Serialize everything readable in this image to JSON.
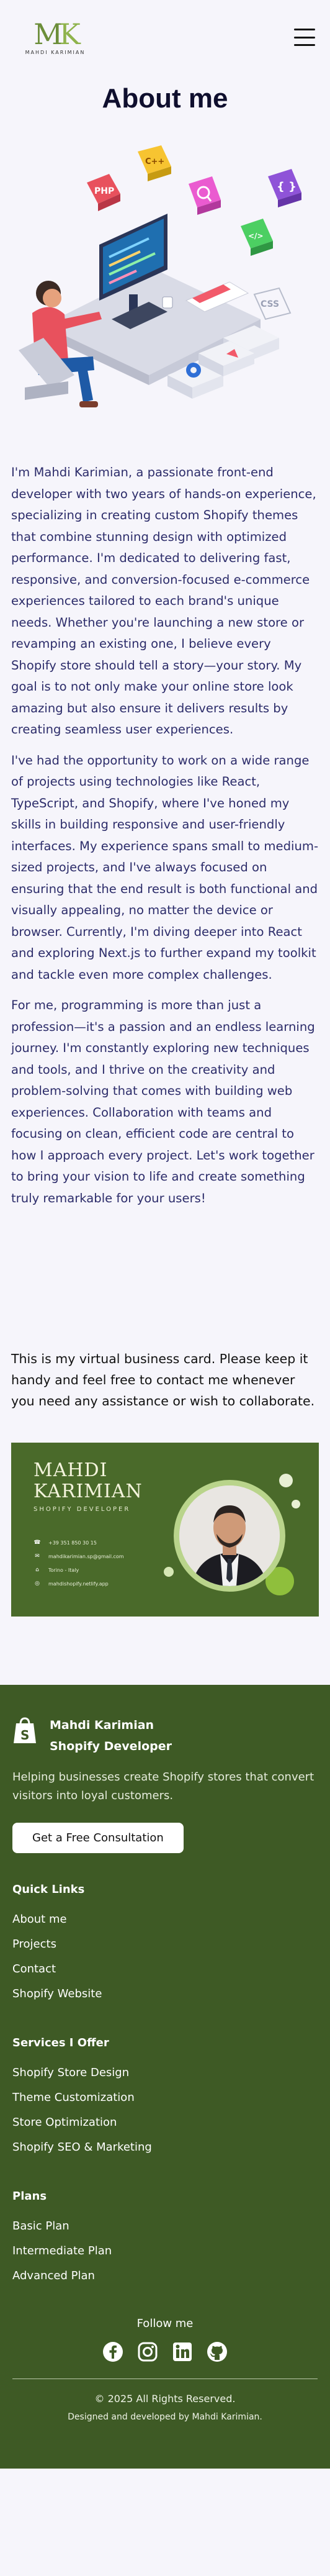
{
  "header": {
    "logo_mark_m": "M",
    "logo_mark_k": "K",
    "logo_sub": "MAHDI KARIMIAN"
  },
  "hero": {
    "title": "About me",
    "badges": [
      "PHP",
      "C++",
      "</>",
      "CSS"
    ]
  },
  "about": {
    "paragraphs": [
      "I'm Mahdi Karimian, a passionate front-end developer with two years of hands-on experience, specializing in creating custom Shopify themes that combine stunning design with optimized performance. I'm dedicated to delivering fast, responsive, and conversion-focused e-commerce experiences tailored to each brand's unique needs. Whether you're launching a new store or revamping an existing one, I believe every Shopify store should tell a story—your story. My goal is to not only make your online store look amazing but also ensure it delivers results by creating seamless user experiences.",
      "I've had the opportunity to work on a wide range of projects using technologies like React, TypeScript, and Shopify, where I've honed my skills in building responsive and user-friendly interfaces. My experience spans small to medium-sized projects, and I've always focused on ensuring that the end result is both functional and visually appealing, no matter the device or browser. Currently, I'm diving deeper into React and exploring Next.js to further expand my toolkit and tackle even more complex challenges.",
      "For me, programming is more than just a profession—it's a passion and an endless learning journey. I'm constantly exploring new techniques and tools, and I thrive on the creativity and problem-solving that comes with building web experiences. Collaboration with teams and focusing on clean, efficient code are central to how I approach every project. Let's work together to bring your vision to life and create something truly remarkable for your users!"
    ]
  },
  "vcard": {
    "intro": "This is my virtual business card. Please keep it handy and feel free to contact me whenever you need any assistance or wish to collaborate.",
    "name_line1": "MAHDI",
    "name_line2": "KARIMIAN",
    "role": "SHOPIFY DEVELOPER",
    "contacts": [
      {
        "icon": "phone-icon",
        "text": "+39 351 850 30 15"
      },
      {
        "icon": "mail-icon",
        "text": "mahdikarimian.sp@gmail.com"
      },
      {
        "icon": "location-icon",
        "text": "Torino - Italy"
      },
      {
        "icon": "globe-icon",
        "text": "mahdishopify.netlify.app"
      }
    ],
    "colors": {
      "bg": "#4a6a2a",
      "accent": "#b9d48b"
    }
  },
  "footer": {
    "brand_line1": "Mahdi Karimian",
    "brand_line2": "Shopify Developer",
    "description": "Helping businesses create Shopify stores that convert visitors into loyal customers.",
    "cta": "Get a Free Consultation",
    "quick_links": {
      "title": "Quick Links",
      "items": [
        "About me",
        "Projects",
        "Contact",
        "Shopify Website"
      ]
    },
    "services": {
      "title": "Services I Offer",
      "items": [
        "Shopify Store Design",
        "Theme Customization",
        "Store Optimization",
        "Shopify SEO & Marketing"
      ]
    },
    "plans": {
      "title": "Plans",
      "items": [
        "Basic Plan",
        "Intermediate Plan",
        "Advanced Plan"
      ]
    },
    "follow": "Follow me",
    "socials": [
      "facebook-icon",
      "instagram-icon",
      "linkedin-icon",
      "github-icon"
    ],
    "copyright": "© 2025 All Rights Reserved.",
    "credit": "Designed and developed by Mahdi Karimian."
  }
}
